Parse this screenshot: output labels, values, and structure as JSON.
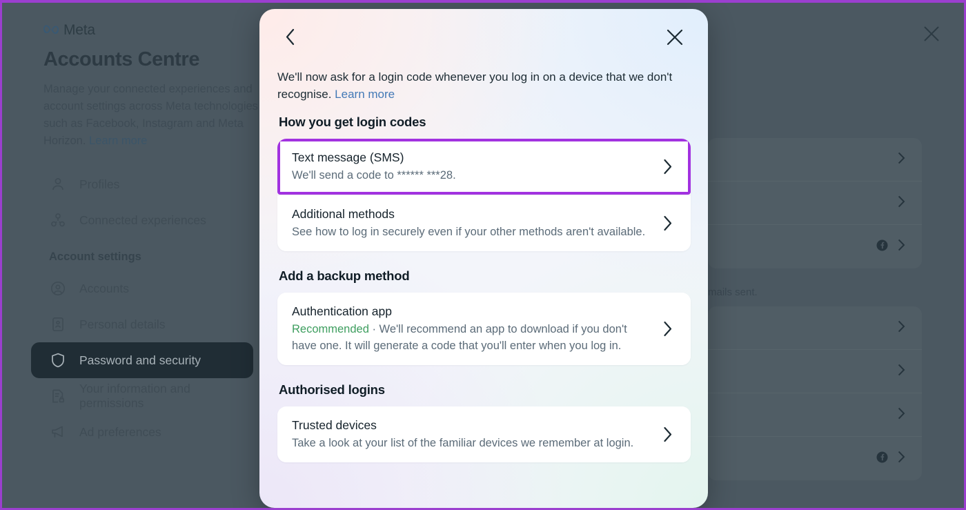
{
  "background": {
    "brand": {
      "name": "Meta",
      "logo_icon": "meta-infinity-icon"
    },
    "title": "Accounts Centre",
    "description": "Manage your connected experiences and account settings across Meta technologies such as Facebook, Instagram and Meta Horizon.",
    "description_link": "Learn more",
    "nav": [
      {
        "label": "Profiles",
        "icon": "person-icon",
        "active": false
      },
      {
        "label": "Connected experiences",
        "icon": "nodes-icon",
        "active": false
      }
    ],
    "nav_section_label": "Account settings",
    "nav_settings": [
      {
        "label": "Accounts",
        "icon": "account-circle-icon",
        "active": false
      },
      {
        "label": "Personal details",
        "icon": "id-card-icon",
        "active": false
      },
      {
        "label": "Password and security",
        "icon": "shield-icon",
        "active": true
      },
      {
        "label": "Your information and permissions",
        "icon": "document-lock-icon",
        "active": false
      },
      {
        "label": "Ad preferences",
        "icon": "megaphone-icon",
        "active": false
      }
    ],
    "panel_note": "mails sent.",
    "close_icon": "close-icon",
    "row_icons": {
      "chevron": "chevron-right-icon",
      "facebook": "facebook-icon"
    }
  },
  "modal": {
    "back_icon": "chevron-left-icon",
    "close_icon": "close-icon",
    "intro": "We'll now ask for a login code whenever you log in on a device that we don't recognise. ",
    "intro_link": "Learn more",
    "sections": [
      {
        "heading": "How you get login codes",
        "rows": [
          {
            "title": "Text message (SMS)",
            "subtitle": "We'll send a code to ****** ***28.",
            "highlighted": true,
            "chevron_icon": "chevron-right-icon"
          },
          {
            "title": "Additional methods",
            "subtitle": "See how to log in securely even if your other methods aren't available.",
            "highlighted": false,
            "chevron_icon": "chevron-right-icon"
          }
        ]
      },
      {
        "heading": "Add a backup method",
        "rows": [
          {
            "title": "Authentication app",
            "badge": "Recommended",
            "subtitle": " · We'll recommend an app to download if you don't have one. It will generate a code that you'll enter when you log in.",
            "highlighted": false,
            "chevron_icon": "chevron-right-icon"
          }
        ]
      },
      {
        "heading": "Authorised logins",
        "rows": [
          {
            "title": "Trusted devices",
            "subtitle": "Take a look at your list of the familiar devices we remember at login.",
            "highlighted": false,
            "chevron_icon": "chevron-right-icon"
          }
        ]
      }
    ]
  },
  "colors": {
    "highlight_purple": "#a232e0",
    "frame_purple": "#9b3fcf",
    "recommended_green": "#3e9e5f",
    "link_blue": "#4379b6",
    "backdrop": "#4b5861"
  }
}
